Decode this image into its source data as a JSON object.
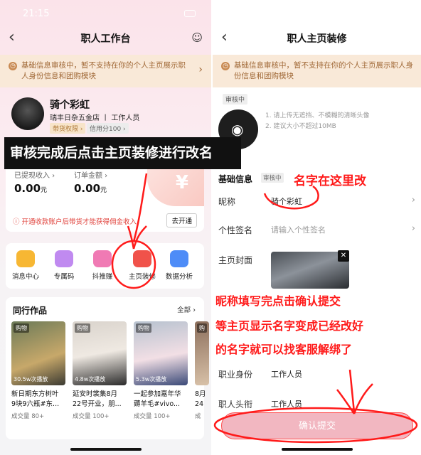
{
  "left": {
    "time": "21:15",
    "title": "职人工作台",
    "notice": "基础信息审核中，暂不支持在你的个人主页展示职人身份信息和团购模块",
    "profile": {
      "name": "骑个彩虹",
      "shop": "瑞丰日杂五金店 丨 工作人员",
      "tag1": "带货权限 ›",
      "tag2": "信用分100 ›"
    },
    "income": {
      "withdrawn_label": "已提现收入 ›",
      "withdrawn_value": "0.00",
      "withdrawn_unit": "元",
      "orders_label": "订单金额 ›",
      "orders_value": "0.00",
      "orders_unit": "元",
      "coin_symbol": "¥",
      "alert": "开通收款账户后带货才能获得佣金收入",
      "open_button": "去开通"
    },
    "tools": [
      {
        "label": "消息中心",
        "icon": "message-icon",
        "color": "#f7b733"
      },
      {
        "label": "专属码",
        "icon": "qrcode-icon",
        "color": "#c08af0"
      },
      {
        "label": "抖推赚",
        "icon": "person-icon",
        "color": "#f07ab4"
      },
      {
        "label": "主页装修",
        "icon": "home-decor-icon",
        "color": "#f0524a"
      },
      {
        "label": "数据分析",
        "icon": "chart-icon",
        "color": "#4e8cf7"
      }
    ],
    "works": {
      "title": "同行作品",
      "all": "全部 ›",
      "cards": [
        {
          "tag": "购物",
          "views": "30.5w次播放",
          "title": "新日期东方树叶",
          "title2": "9块9六瓶#东...",
          "sales": "成交量 80+"
        },
        {
          "tag": "购物",
          "views": "4.8w次播放",
          "title": "延安时裳集8月",
          "title2": "22号开业，朋...",
          "sales": "成交量 100+"
        },
        {
          "tag": "购物",
          "views": "5.3w次播放",
          "title": "一起参加嘉年华",
          "title2": "薅羊毛#vivo...",
          "sales": "成交量 100+"
        },
        {
          "tag": "购",
          "views": "",
          "title": "8月",
          "title2": "24",
          "sales": "成"
        }
      ]
    },
    "banner": "审核完成后点击主页装修进行改名"
  },
  "right": {
    "title": "职人主页装修",
    "notice": "基础信息审核中，暂不支持在你的个人主页展示职人身份信息和团购模块",
    "review_badge": "审核中",
    "hint1": "1. 请上传无遮挡、不模糊的清晰头像",
    "hint2": "2. 建议大小不超过10MB",
    "section_title": "基础信息",
    "section_badge": "审核中",
    "nickname_label": "昵称",
    "nickname_value": "骑个彩虹",
    "signature_label": "个性签名",
    "signature_placeholder": "请输入个性签名",
    "cover_label": "主页封面",
    "job_label": "职业身份",
    "job_value": "工作人员",
    "title_label": "职人头衔",
    "title_value": "工作人员",
    "confirm_button": "确认提交",
    "note_name": "名字在这里改",
    "note_line1": "昵称填写完点击确认提交",
    "note_line2": "等主页显示名字变成已经改好",
    "note_line3": "的名字就可以找客服解绑了"
  },
  "colors": {
    "annotation_red": "#ff1a1a",
    "notice_bg": "#f9e9d8",
    "confirm_bg": "#f2b7c1"
  }
}
